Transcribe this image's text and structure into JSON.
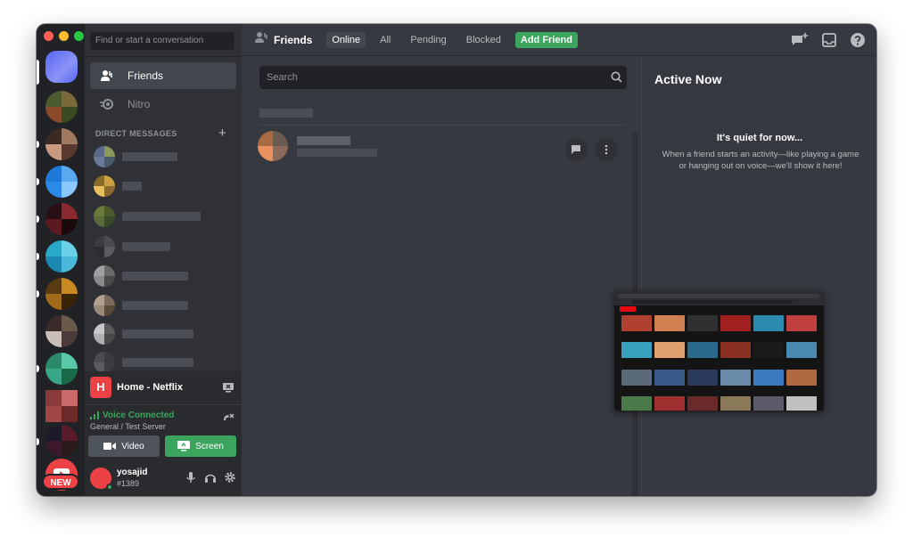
{
  "search_conversation": {
    "placeholder": "Find or start a conversation"
  },
  "nav": [
    {
      "label": "Friends",
      "icon": "friends-icon"
    },
    {
      "label": "Nitro",
      "icon": "nitro-icon"
    }
  ],
  "direct_messages_header": "DIRECT MESSAGES",
  "rail": {
    "new_badge": "NEW"
  },
  "stream": {
    "avatar_letter": "H",
    "title": "Home - Netflix"
  },
  "voice": {
    "status": "Voice Connected",
    "channel": "General / Test Server",
    "video_label": "Video",
    "screen_label": "Screen"
  },
  "user": {
    "name": "yosajid",
    "tag": "#1389"
  },
  "topbar": {
    "title": "Friends",
    "tabs": [
      "Online",
      "All",
      "Pending",
      "Blocked"
    ],
    "add_friend": "Add Friend"
  },
  "friends_search": {
    "placeholder": "Search"
  },
  "active_now": {
    "title": "Active Now",
    "quiet_title": "It's quiet for now...",
    "quiet_desc": "When a friend starts an activity—like playing a game or hanging out on voice—we'll show it here!"
  },
  "colors": {
    "brand": "#5865f2",
    "green": "#3ba55d",
    "red": "#ed4245",
    "bg_main": "#36393f",
    "bg_sidebar": "#2f3136",
    "bg_rail": "#202225"
  }
}
